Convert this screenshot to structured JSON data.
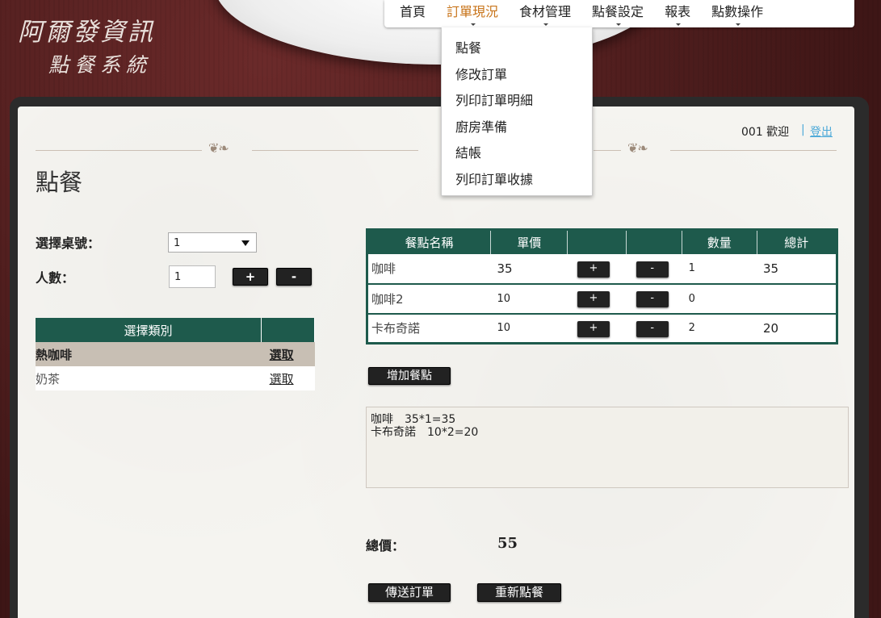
{
  "logo": {
    "line1": "阿爾發資訊",
    "line2": "點餐系統"
  },
  "nav": {
    "items": [
      {
        "label": "首頁",
        "active": false,
        "caret": false
      },
      {
        "label": "訂單現況",
        "active": true,
        "caret": true
      },
      {
        "label": "食材管理",
        "active": false,
        "caret": true
      },
      {
        "label": "點餐設定",
        "active": false,
        "caret": true
      },
      {
        "label": "報表",
        "active": false,
        "caret": true
      },
      {
        "label": "點數操作",
        "active": false,
        "caret": true
      }
    ]
  },
  "dropdown": {
    "items": [
      "點餐",
      "修改訂單",
      "列印訂單明細",
      "廚房準備",
      "結帳",
      "列印訂單收據"
    ]
  },
  "user": {
    "welcome": "001 歡迎",
    "separator": "|",
    "logout": "登出"
  },
  "page": {
    "title": "點餐"
  },
  "form": {
    "table_label": "選擇桌號：",
    "table_value": "1",
    "people_label": "人數：",
    "people_value": "1",
    "plus": "+",
    "minus": "-"
  },
  "category": {
    "header": "選擇類別",
    "rows": [
      {
        "name": "熱咖啡",
        "action": "選取"
      },
      {
        "name": "奶茶",
        "action": "選取"
      }
    ]
  },
  "order": {
    "headers": [
      "餐點名稱",
      "單價",
      "",
      "",
      "數量",
      "總計"
    ],
    "rows": [
      {
        "name": "咖啡",
        "price": "35",
        "qty": "1",
        "total": "35"
      },
      {
        "name": "咖啡2",
        "price": "10",
        "qty": "0",
        "total": ""
      },
      {
        "name": "卡布奇諾",
        "price": "10",
        "qty": "2",
        "total": "20"
      }
    ],
    "add_button": "增加餐點"
  },
  "summary": {
    "lines": [
      "咖啡　35*1=35",
      "卡布奇諾　10*2=20"
    ]
  },
  "total": {
    "label": "總價：",
    "value": "55"
  },
  "actions": {
    "submit": "傳送訂單",
    "reset": "重新點餐"
  },
  "colors": {
    "table_header": "#1e5a4c",
    "nav_active": "#c8741a",
    "link": "#4aa8d8"
  }
}
